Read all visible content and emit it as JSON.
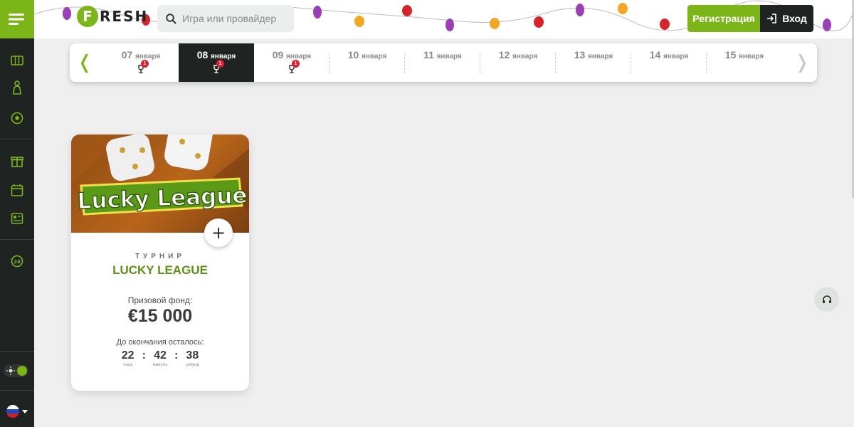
{
  "brand": {
    "logo_letter": "F",
    "logo_text": "RESH",
    "accent": "#7cb518",
    "dark": "#1f2321"
  },
  "search": {
    "placeholder": "Игра или провайдер"
  },
  "auth": {
    "register_label": "Регистрация",
    "login_label": "Вход"
  },
  "sidebar": {
    "items": [
      {
        "icon": "slots-icon"
      },
      {
        "icon": "live-casino-icon"
      },
      {
        "icon": "sports-icon"
      },
      {
        "icon": "gift-icon"
      },
      {
        "icon": "calendar-icon"
      },
      {
        "icon": "news-icon"
      },
      {
        "icon": "support-24-icon"
      }
    ],
    "language": "ru"
  },
  "dates": {
    "prev_icon": "chevron-left-icon",
    "next_icon": "chevron-right-icon",
    "days": [
      {
        "day": "07",
        "month": "января",
        "badge": "1",
        "active": false
      },
      {
        "day": "08",
        "month": "января",
        "badge": "1",
        "active": true
      },
      {
        "day": "09",
        "month": "января",
        "badge": "1",
        "active": false
      },
      {
        "day": "10",
        "month": "января",
        "badge": null,
        "active": false
      },
      {
        "day": "11",
        "month": "января",
        "badge": null,
        "active": false
      },
      {
        "day": "12",
        "month": "января",
        "badge": null,
        "active": false
      },
      {
        "day": "13",
        "month": "января",
        "badge": null,
        "active": false
      },
      {
        "day": "14",
        "month": "января",
        "badge": null,
        "active": false
      },
      {
        "day": "15",
        "month": "января",
        "badge": null,
        "active": false
      }
    ]
  },
  "tournament": {
    "banner_text": "Lucky League",
    "kind": "ТУРНИР",
    "name": "LUCKY LEAGUE",
    "prize_label": "Призовой фонд:",
    "prize": "€15 000",
    "remaining_label": "До окончания осталось:",
    "timer": [
      {
        "value": "22",
        "unit": "часа"
      },
      {
        "value": "42",
        "unit": "минуты"
      },
      {
        "value": "38",
        "unit": "секунд"
      }
    ],
    "add_label": "+"
  }
}
